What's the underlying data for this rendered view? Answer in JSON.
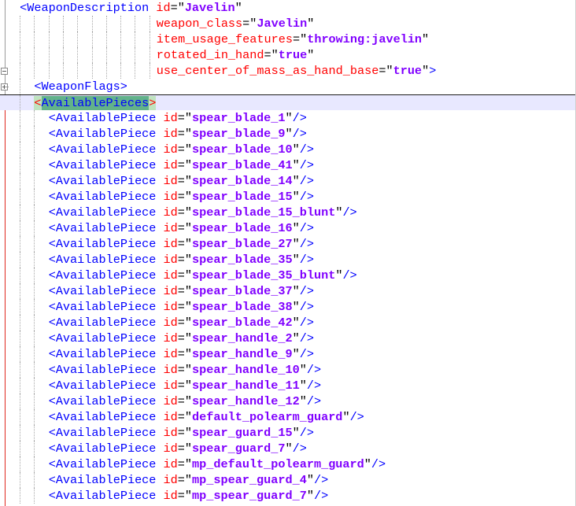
{
  "editor": {
    "weapon_description": {
      "tag": "WeaponDescription",
      "attributes": [
        {
          "name": "id",
          "value": "Javelin"
        },
        {
          "name": "weapon_class",
          "value": "Javelin"
        },
        {
          "name": "item_usage_features",
          "value": "throwing:javelin"
        },
        {
          "name": "rotated_in_hand",
          "value": "true"
        },
        {
          "name": "use_center_of_mass_as_hand_base",
          "value": "true"
        }
      ]
    },
    "weapon_flags_tag": "WeaponFlags",
    "available_pieces_tag": "AvailablePieces",
    "piece_tag": "AvailablePiece",
    "piece_attr": "id",
    "pieces": [
      "spear_blade_1",
      "spear_blade_9",
      "spear_blade_10",
      "spear_blade_41",
      "spear_blade_14",
      "spear_blade_15",
      "spear_blade_15_blunt",
      "spear_blade_16",
      "spear_blade_27",
      "spear_blade_35",
      "spear_blade_35_blunt",
      "spear_blade_37",
      "spear_blade_38",
      "spear_blade_42",
      "spear_handle_2",
      "spear_handle_9",
      "spear_handle_10",
      "spear_handle_11",
      "spear_handle_12",
      "default_polearm_guard",
      "spear_guard_15",
      "spear_guard_7",
      "mp_default_polearm_guard",
      "mp_spear_guard_4",
      "mp_spear_guard_7"
    ],
    "colors": {
      "tag": "#0000ff",
      "attribute": "#ff0000",
      "value": "#8000ff",
      "current_line": "#e8e8ff",
      "matched_tag_highlight": "#62b28a"
    }
  }
}
